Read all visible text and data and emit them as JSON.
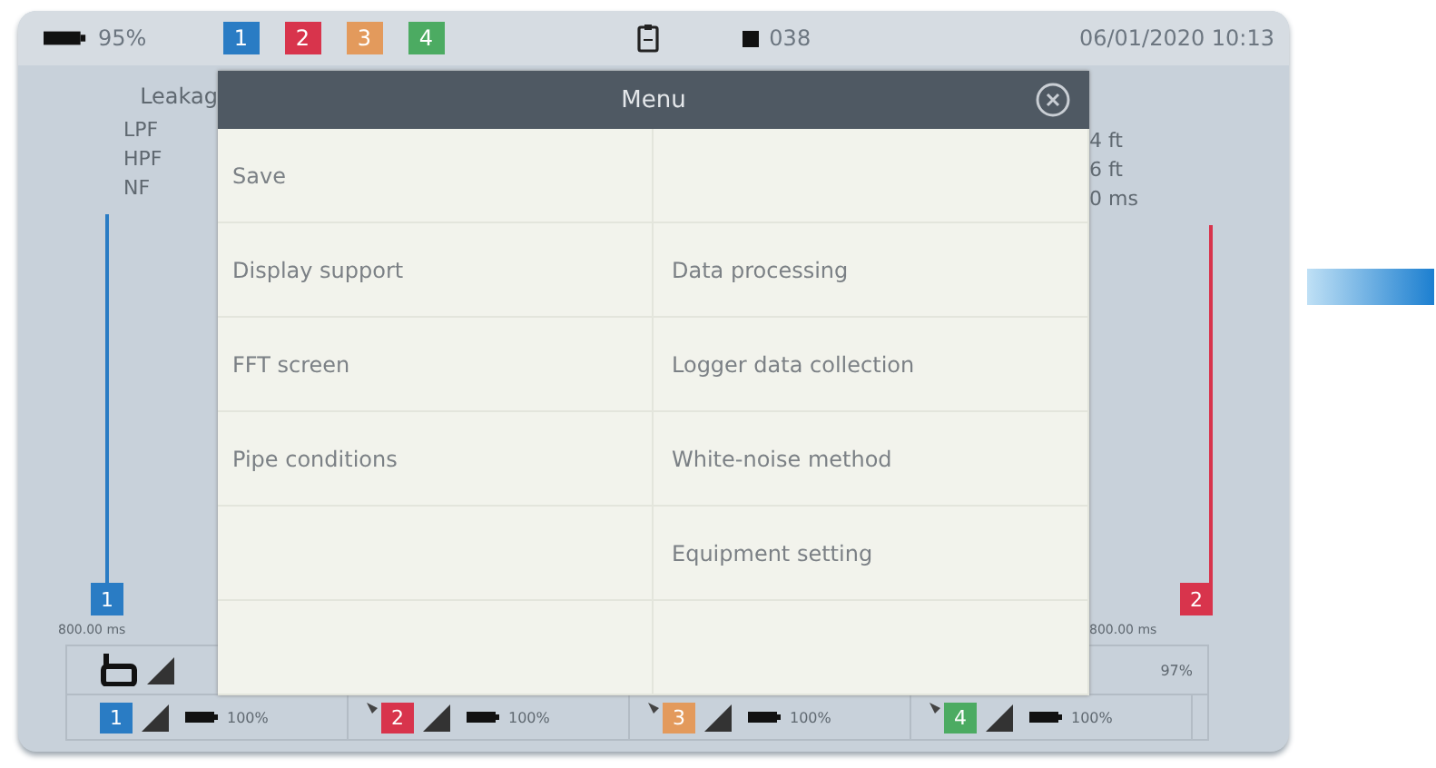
{
  "status_bar": {
    "battery": "95%",
    "channels": [
      {
        "label": "1",
        "color": "#2a7cc4"
      },
      {
        "label": "2",
        "color": "#d8344c"
      },
      {
        "label": "3",
        "color": "#e39a5c"
      },
      {
        "label": "4",
        "color": "#4cab62"
      }
    ],
    "counter": "038",
    "datetime": "06/01/2020 10:13"
  },
  "left_panel": {
    "title": "Leakag",
    "filters": [
      "LPF",
      "HPF",
      "NF"
    ],
    "channel": {
      "label": "1",
      "color": "#2a7cc4"
    },
    "time": "800.00 ms"
  },
  "right_panel": {
    "values": [
      "4 ft",
      "6 ft",
      "0 ms"
    ],
    "channel": {
      "label": "2",
      "color": "#d8344c"
    },
    "time": "800.00 ms"
  },
  "logger_bar": {
    "reading": "97%"
  },
  "sensors": [
    {
      "label": "1",
      "color": "#2a7cc4",
      "linked": false,
      "battery": "100%"
    },
    {
      "label": "2",
      "color": "#d8344c",
      "linked": true,
      "battery": "100%"
    },
    {
      "label": "3",
      "color": "#e39a5c",
      "linked": true,
      "battery": "100%"
    },
    {
      "label": "4",
      "color": "#4cab62",
      "linked": true,
      "battery": "100%"
    }
  ],
  "menu": {
    "title": "Menu",
    "rows": [
      {
        "left": "Save"
      },
      {
        "left": "Display support",
        "right": "Data processing"
      },
      {
        "left": "FFT screen",
        "right": "Logger data collection"
      },
      {
        "left": "Pipe conditions",
        "right": "White-noise method"
      },
      {
        "right": "Equipment setting"
      },
      {}
    ]
  }
}
